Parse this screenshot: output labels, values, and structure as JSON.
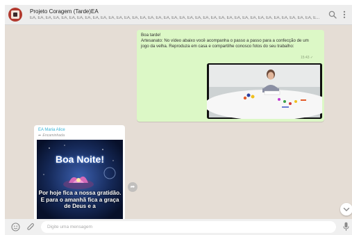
{
  "header": {
    "group_name": "Projeto Coragem (Tarde)EA",
    "members": "EA, EA, EA, EA, EA, EA, EA, EA, EA, EA, EA, EA, EA, EA, EA, EA, EA, EA, EA, EA, EA, EA, EA, EA, EA, EA, EA, EA, EA, EA, EA, EA, EA, EA, EA, EA, E..."
  },
  "messages": {
    "outgoing": {
      "line1": "Boa tarde!",
      "line2": "Artesanato: No vídeo abaixo você acompanha o passo a passo para a confecção de um jogo da velha. Reproduza em casa e compartilhe conosco fotos do seu trabalho:",
      "time": "15:43 ✓"
    },
    "incoming": {
      "sender": "EA Maria Alice",
      "forwarded_label": "Encaminhada",
      "image_title": "Boa Noite!",
      "image_caption": "Por hoje fica a nossa gratidão. E para o amanhã fica a graça de Deus e a"
    }
  },
  "footer": {
    "placeholder": "Digite uma mensagem"
  },
  "icons": {
    "search": "search-icon",
    "menu": "menu-icon",
    "emoji": "emoji-icon",
    "attach": "clip-icon",
    "mic": "mic-icon",
    "forward": "forward-icon",
    "scroll_down": "chevron-down-icon"
  },
  "colors": {
    "outgoing_bubble": "#dcf8c6",
    "chat_background": "#e5ddd5",
    "sender_name": "#35b2d6"
  }
}
